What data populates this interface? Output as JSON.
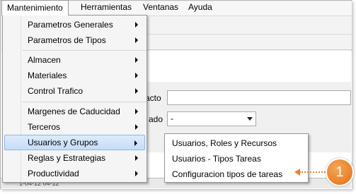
{
  "menubar": {
    "items": [
      {
        "label": "Mantenimiento"
      },
      {
        "label": "Herramientas"
      },
      {
        "label": "Ventanas"
      },
      {
        "label": "Ayuda"
      }
    ]
  },
  "form": {
    "label_1": "acto",
    "label_2": "ado",
    "select_value": "-"
  },
  "grid_strip_text": "1-04-12        04-12",
  "dropdown": {
    "items": [
      {
        "label": "Parametros Generales"
      },
      {
        "label": "Parametros de Tipos"
      },
      {
        "label": "Almacen"
      },
      {
        "label": "Materiales"
      },
      {
        "label": "Control Trafico"
      },
      {
        "label": "Margenes de Caducidad"
      },
      {
        "label": "Terceros"
      },
      {
        "label": "Usuarios y Grupos"
      },
      {
        "label": "Reglas y Estrategias"
      },
      {
        "label": "Productividad"
      }
    ]
  },
  "submenu": {
    "items": [
      {
        "label": "Usuarios, Roles y Recursos"
      },
      {
        "label": "Usuarios - Tipos Tareas"
      },
      {
        "label": "Configuracion tipos de tareas"
      }
    ]
  },
  "callout": {
    "number": "1",
    "color": "#e8812f"
  }
}
